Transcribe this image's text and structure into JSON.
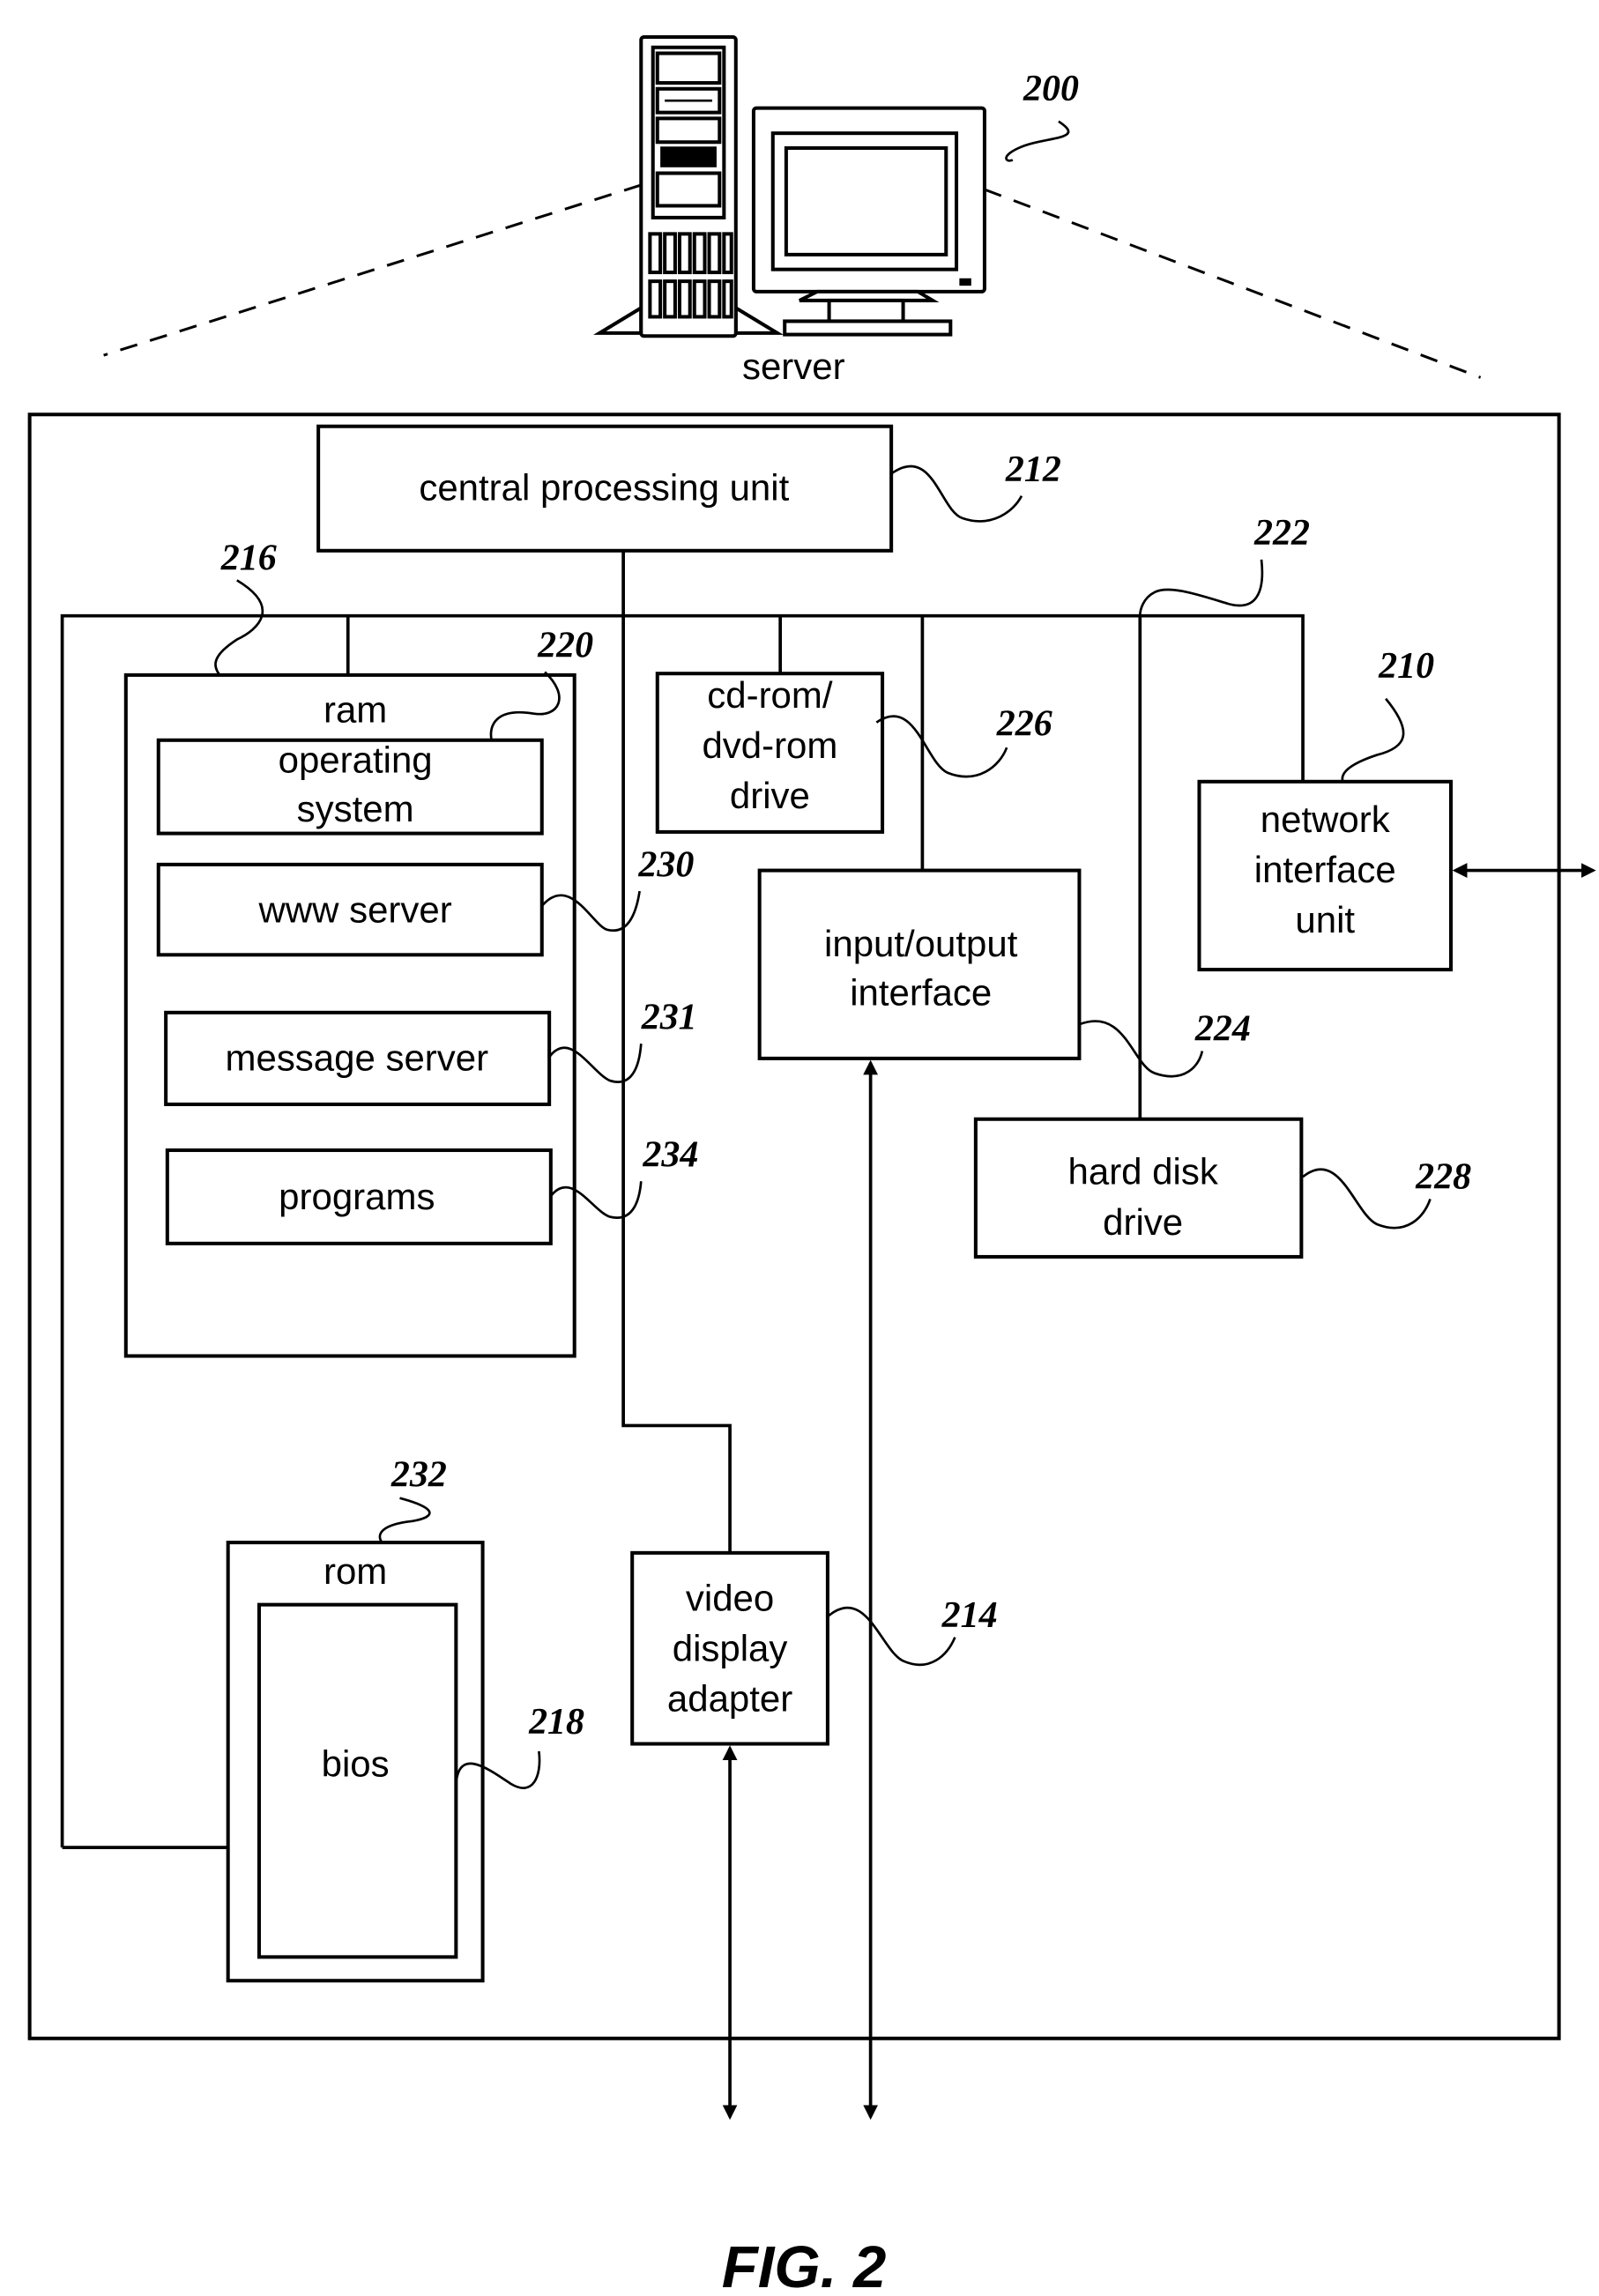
{
  "figure": {
    "caption": "FIG. 2",
    "server_label": "server",
    "server_ref": "200"
  },
  "components": {
    "cpu": {
      "label": "central processing unit",
      "ref": "212"
    },
    "bus": {
      "ref": "222"
    },
    "memory_bus": {
      "ref": "216"
    },
    "ram": {
      "label": "ram",
      "ref": "220"
    },
    "operating_system": {
      "line1": "operating",
      "line2": "system"
    },
    "www_server": {
      "label": "www server",
      "ref": "230"
    },
    "message_server": {
      "label": "message server",
      "ref": "231"
    },
    "programs": {
      "label": "programs",
      "ref": "234"
    },
    "cdrom": {
      "line1": "cd-rom/",
      "line2": "dvd-rom",
      "line3": "drive",
      "ref": "226"
    },
    "io_interface": {
      "line1": "input/output",
      "line2": "interface",
      "ref": "224"
    },
    "network_interface": {
      "line1": "network",
      "line2": "interface",
      "line3": "unit",
      "ref": "210"
    },
    "hard_disk": {
      "line1": "hard disk",
      "line2": "drive",
      "ref": "228"
    },
    "rom": {
      "label": "rom",
      "ref": "232"
    },
    "bios": {
      "label": "bios",
      "ref": "218"
    },
    "video_adapter": {
      "line1": "video",
      "line2": "display",
      "line3": "adapter",
      "ref": "214"
    }
  }
}
